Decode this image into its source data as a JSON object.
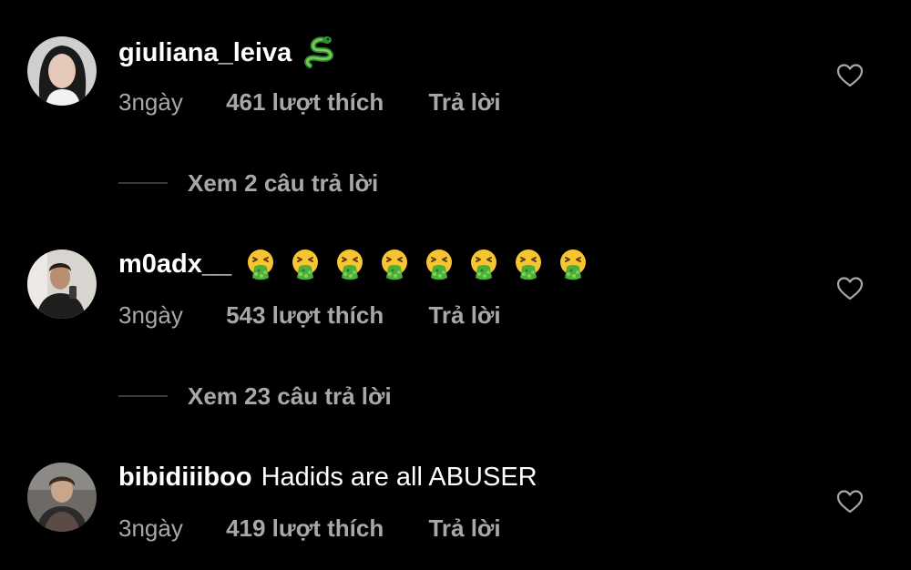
{
  "comments": [
    {
      "username": "giuliana_leiva",
      "text": "",
      "emoji": "snake-emoji",
      "age": "3ngày",
      "likes": "461 lượt thích",
      "reply_label": "Trả lời",
      "view_replies": "Xem 2 câu trả lời"
    },
    {
      "username": "m0adx__",
      "text": "",
      "emoji": "vomiting-face-emoji",
      "emoji_count": 8,
      "age": "3ngày",
      "likes": "543 lượt thích",
      "reply_label": "Trả lời",
      "view_replies": "Xem 23 câu trả lời"
    },
    {
      "username": "bibidiiiboo",
      "text": "Hadids are all ABUSER",
      "age": "3ngày",
      "likes": "419 lượt thích",
      "reply_label": "Trả lời"
    }
  ],
  "icons": {
    "heart": "heart-outline-icon"
  },
  "colors": {
    "background": "#000000",
    "primary_text": "#ffffff",
    "secondary_text": "#a8a8a8",
    "divider": "#3a3a3a"
  }
}
